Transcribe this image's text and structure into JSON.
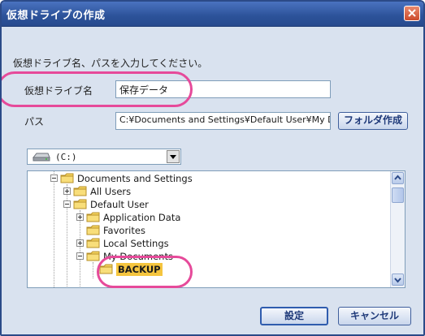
{
  "window": {
    "title": "仮想ドライブの作成"
  },
  "instructions": "仮想ドライブ名、パスを入力してください。",
  "form": {
    "name_label": "仮想ドライブ名",
    "name_value": "保存データ",
    "path_label": "パス",
    "path_value": "C:¥Documents and Settings¥Default User¥My D",
    "make_folder_button": "フォルダ作成"
  },
  "drive_select": {
    "value": "(C:)"
  },
  "tree": {
    "nodes": [
      {
        "label": "Documents and Settings",
        "expander": "minus",
        "level": 0
      },
      {
        "label": "All Users",
        "expander": "plus",
        "level": 1
      },
      {
        "label": "Default User",
        "expander": "minus",
        "level": 1
      },
      {
        "label": "Application Data",
        "expander": "plus",
        "level": 2
      },
      {
        "label": "Favorites",
        "expander": "none",
        "level": 2
      },
      {
        "label": "Local Settings",
        "expander": "plus",
        "level": 2
      },
      {
        "label": "My Documents",
        "expander": "minus",
        "level": 2
      },
      {
        "label": "BACKUP",
        "expander": "none",
        "level": 3,
        "selected": true
      }
    ]
  },
  "buttons": {
    "ok": "設定",
    "cancel": "キャンセル"
  },
  "colors": {
    "highlight": "#e64a9a",
    "title_bar": "#2c5299",
    "selection": "#f5c53f"
  }
}
